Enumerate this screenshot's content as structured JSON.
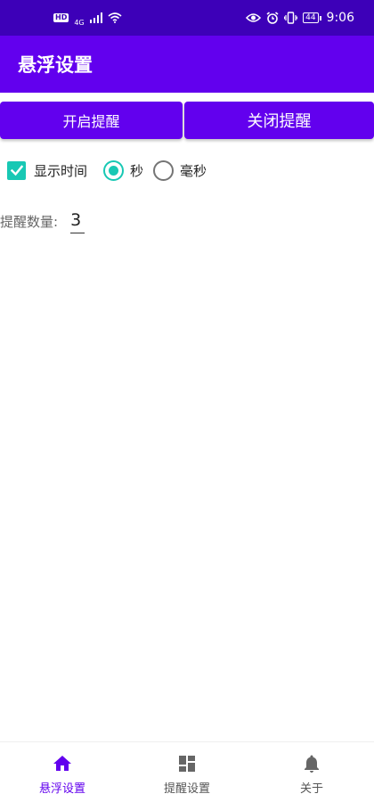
{
  "status_bar": {
    "hd_badge": "HD",
    "network": "4G",
    "battery": "44",
    "time": "9:06"
  },
  "app_bar": {
    "title": "悬浮设置"
  },
  "buttons": {
    "open_label": "开启提醒",
    "close_label": "关闭提醒"
  },
  "options": {
    "show_time_label": "显示时间",
    "show_time_checked": true,
    "unit_seconds_label": "秒",
    "unit_ms_label": "毫秒",
    "selected_unit": "秒"
  },
  "reminder_count": {
    "label": "提醒数量:",
    "value": "3"
  },
  "bottom_nav": {
    "items": [
      {
        "label": "悬浮设置",
        "icon": "home-icon",
        "active": true
      },
      {
        "label": "提醒设置",
        "icon": "dashboard-icon",
        "active": false
      },
      {
        "label": "关于",
        "icon": "bell-icon",
        "active": false
      }
    ]
  },
  "colors": {
    "status_bar": "#3d00b8",
    "primary": "#6200ee",
    "accent": "#18c8b4"
  }
}
